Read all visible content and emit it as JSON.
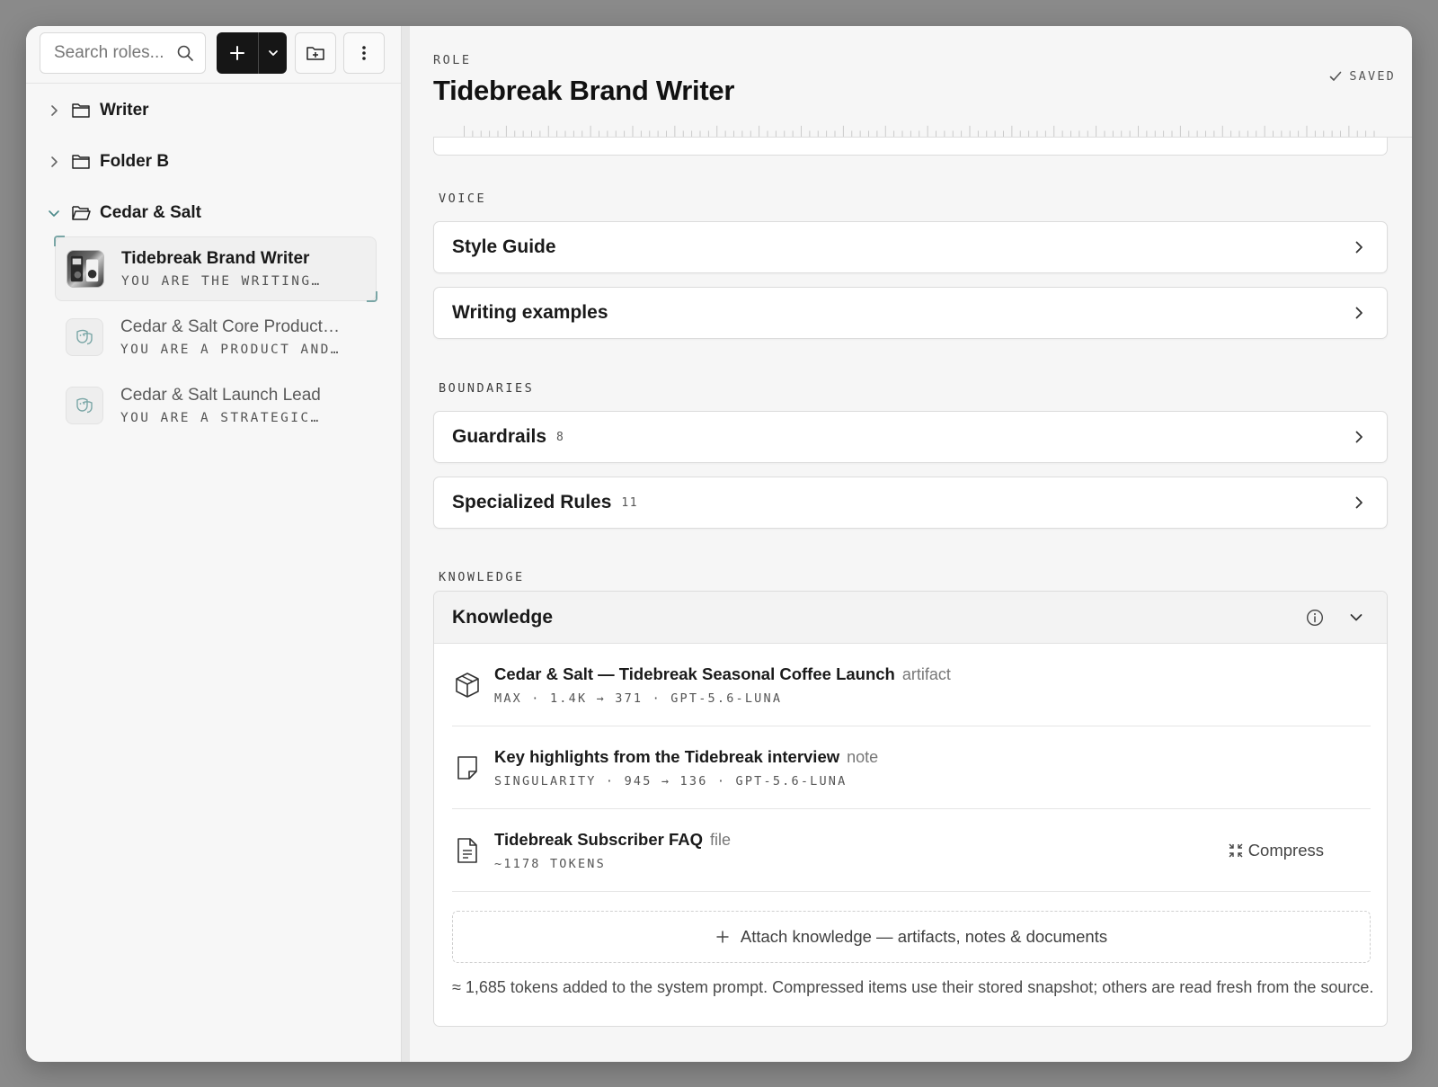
{
  "sidebar": {
    "search": {
      "placeholder": "Search roles..."
    },
    "folders": [
      {
        "label": "Writer",
        "expanded": false
      },
      {
        "label": "Folder B",
        "expanded": false
      },
      {
        "label": "Cedar & Salt",
        "expanded": true
      }
    ],
    "roles": [
      {
        "title": "Tidebreak Brand Writer",
        "desc": "YOU ARE THE WRITING…",
        "active": true
      },
      {
        "title": "Cedar & Salt Core Product…",
        "desc": "YOU ARE A PRODUCT AND…",
        "active": false
      },
      {
        "title": "Cedar & Salt Launch Lead",
        "desc": "YOU ARE A STRATEGIC…",
        "active": false
      }
    ]
  },
  "header": {
    "eyebrow": "ROLE",
    "title": "Tidebreak Brand Writer",
    "status": "SAVED"
  },
  "sections": {
    "voice": {
      "label": "VOICE",
      "items": [
        {
          "label": "Style Guide"
        },
        {
          "label": "Writing examples"
        }
      ]
    },
    "boundaries": {
      "label": "BOUNDARIES",
      "items": [
        {
          "label": "Guardrails",
          "count": "8"
        },
        {
          "label": "Specialized Rules",
          "count": "11"
        }
      ]
    },
    "knowledge": {
      "label": "KNOWLEDGE",
      "card_title": "Knowledge",
      "items": [
        {
          "title": "Cedar & Salt — Tidebreak Seasonal Coffee Launch",
          "type": "artifact",
          "meta": "MAX · 1.4K → 371 · GPT-5.6-LUNA",
          "icon": "cube-icon"
        },
        {
          "title": "Key highlights from the Tidebreak interview",
          "type": "note",
          "meta": "SINGULARITY · 945 → 136 · GPT-5.6-LUNA",
          "icon": "note-icon"
        },
        {
          "title": "Tidebreak Subscriber FAQ",
          "type": "file",
          "meta": "~1178 TOKENS",
          "icon": "document-icon",
          "action": "Compress"
        }
      ],
      "attach_label": "Attach knowledge — artifacts, notes & documents",
      "token_note": "≈ 1,685 tokens added to the system prompt. Compressed items use their stored snapshot; others are read fresh from the source."
    }
  },
  "colors": {
    "accent": "#161616",
    "selection": "#7aa6a6",
    "background": "#f6f6f6"
  }
}
